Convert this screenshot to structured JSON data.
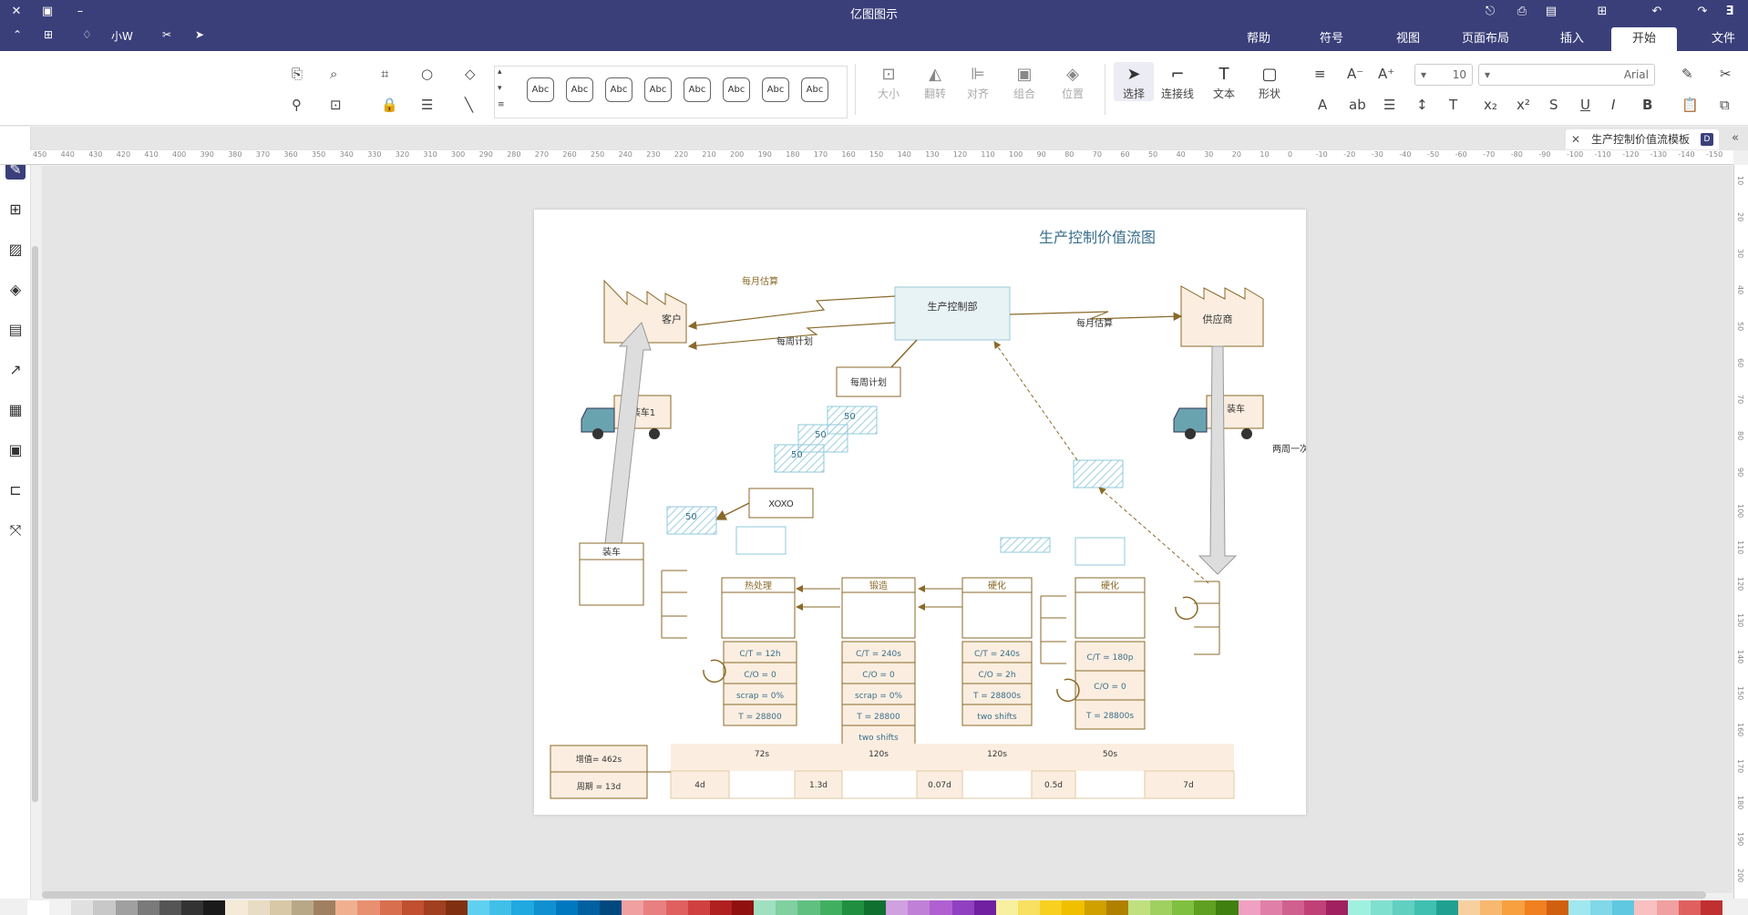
{
  "app": {
    "title": "亿图图示"
  },
  "quick_access": {
    "user": "小W"
  },
  "menu": {
    "tabs": [
      {
        "label": "文件"
      },
      {
        "label": "开始"
      },
      {
        "label": "插入"
      },
      {
        "label": "页面布局"
      },
      {
        "label": "视图"
      },
      {
        "label": "符号"
      },
      {
        "label": "帮助"
      }
    ],
    "active_index": 1
  },
  "ribbon": {
    "font_family": "Arial",
    "font_size": "10",
    "tools": [
      {
        "label": "形状"
      },
      {
        "label": "文本"
      },
      {
        "label": "连接线"
      },
      {
        "label": "选择"
      },
      {
        "label": "位置"
      },
      {
        "label": "组合"
      },
      {
        "label": "对齐"
      },
      {
        "label": "翻转"
      },
      {
        "label": "大小"
      }
    ],
    "style_label": "Abc"
  },
  "document": {
    "tab_title": "生产控制价值流模板",
    "badge": "D"
  },
  "ruler_h": [
    "-150",
    "-140",
    "-130",
    "-120",
    "-110",
    "-100",
    "-90",
    "-80",
    "-70",
    "-60",
    "-50",
    "-40",
    "-30",
    "-20",
    "-10",
    "0",
    "10",
    "20",
    "30",
    "40",
    "50",
    "60",
    "70",
    "80",
    "90",
    "100",
    "110",
    "120",
    "130",
    "140",
    "150",
    "160",
    "170",
    "180",
    "190",
    "200",
    "210",
    "220",
    "230",
    "240",
    "250",
    "260",
    "270",
    "280",
    "290",
    "300",
    "310",
    "320",
    "330",
    "340",
    "350",
    "360",
    "370",
    "380",
    "390",
    "400",
    "410",
    "420",
    "430",
    "440",
    "450"
  ],
  "ruler_v": [
    "10",
    "20",
    "30",
    "40",
    "50",
    "60",
    "70",
    "80",
    "90",
    "100",
    "110",
    "120",
    "130",
    "140",
    "150",
    "160",
    "170",
    "180",
    "190",
    "200"
  ],
  "diagram": {
    "title": "生产控制价值流图",
    "customer": "客户",
    "supplier": "供应商",
    "control": "生产控制部",
    "monthly_forecast_1": "每月估算",
    "weekly_plan_1": "每周计划",
    "monthly_forecast_2": "每月估算",
    "weekly_plan_2": "每周计划",
    "truck_left": "装车1",
    "truck_right": "装车",
    "freq": "两周一次",
    "xoxo": "XOXO",
    "kanban_50": "50",
    "shipping": "装车",
    "processes": [
      {
        "name": "热处理",
        "metrics": [
          "C/T = 12h",
          "C/O = 0",
          "scrap = 0%",
          "T = 28800"
        ]
      },
      {
        "name": "锻造",
        "metrics": [
          "C/T = 240s",
          "C/O = 0",
          "scrap = 0%",
          "T = 28800",
          "two shifts"
        ]
      },
      {
        "name": "硬化",
        "metrics": [
          "C/T = 240s",
          "C/O = 2h",
          "T = 28800s",
          "two shifts"
        ]
      },
      {
        "name": "硬化",
        "metrics": [
          "C/T = 180p",
          "C/O = 0",
          "T = 28800s"
        ]
      }
    ],
    "timeline_upper": [
      "72s",
      "120s",
      "120s",
      "50s"
    ],
    "timeline_lower": [
      "4d",
      "1.3d",
      "0.07d",
      "0.5d",
      "7d"
    ],
    "summary": [
      "增值= 462s",
      "周期 = 13d"
    ]
  },
  "colors": {
    "titlebar": "#3a3f7a",
    "accent_brown": "#8a6a2a",
    "shape_fill": "#fbeee0",
    "control_fill": "#e8f3f6",
    "kanban_blue": "#8fc8dc",
    "text_blue": "#3a6e8a"
  }
}
